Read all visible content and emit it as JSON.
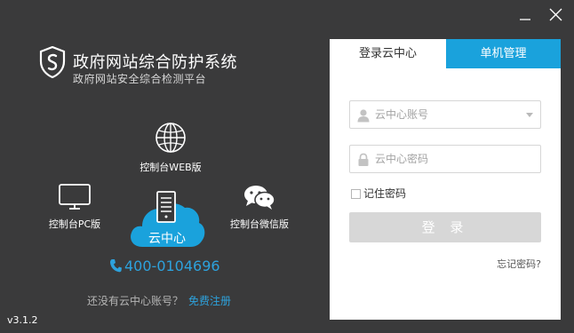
{
  "window": {
    "version": "v3.1.2"
  },
  "brand": {
    "title": "政府网站综合防护系统",
    "subtitle": "政府网站安全综合检测平台"
  },
  "features": {
    "web": "控制台WEB版",
    "pc": "控制台PC版",
    "wechat": "控制台微信版",
    "cloud": "云中心"
  },
  "contact": {
    "phone": "400-0104696"
  },
  "register": {
    "question": "还没有云中心账号？",
    "link": "免费注册"
  },
  "login": {
    "tabs": [
      "登录云中心",
      "单机管理"
    ],
    "account_placeholder": "云中心账号",
    "password_placeholder": "云中心密码",
    "remember_label": "记住密码",
    "login_button": "登 录",
    "forgot": "忘记密码?"
  },
  "colors": {
    "accent": "#1aa2dc",
    "background": "#3a3a3b"
  }
}
